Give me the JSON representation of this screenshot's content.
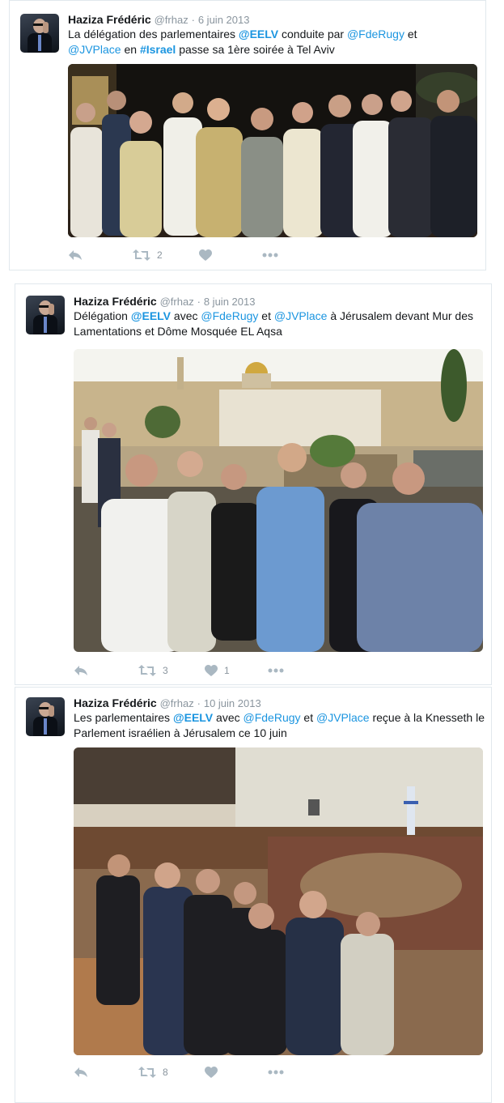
{
  "tweets": [
    {
      "name": "Haziza Frédéric",
      "handle": "@frhaz",
      "date": "6 juin 2013",
      "text": [
        {
          "t": "La délégation des parlementaires "
        },
        {
          "t": "@EELV",
          "link": true,
          "bold": true
        },
        {
          "t": " conduite par "
        },
        {
          "t": "@FdeRugy",
          "link": true
        },
        {
          "t": " et "
        },
        {
          "t": "@JVPlace",
          "link": true
        },
        {
          "t": " en "
        },
        {
          "t": "#Israel",
          "link": true,
          "bold": true
        },
        {
          "t": " passe sa 1ère soirée à Tel Aviv"
        }
      ],
      "retweets": "2",
      "likes": ""
    },
    {
      "name": "Haziza Frédéric",
      "handle": "@frhaz",
      "date": "8 juin 2013",
      "text": [
        {
          "t": "Délégation "
        },
        {
          "t": "@EELV",
          "link": true,
          "bold": true
        },
        {
          "t": " avec "
        },
        {
          "t": "@FdeRugy",
          "link": true
        },
        {
          "t": " et "
        },
        {
          "t": "@JVPlace",
          "link": true
        },
        {
          "t": " à Jérusalem devant Mur des Lamentations et Dôme Mosquée EL Aqsa"
        }
      ],
      "retweets": "3",
      "likes": "1"
    },
    {
      "name": "Haziza Frédéric",
      "handle": "@frhaz",
      "date": "10 juin 2013",
      "text": [
        {
          "t": "Les parlementaires "
        },
        {
          "t": "@EELV",
          "link": true,
          "bold": true
        },
        {
          "t": " avec "
        },
        {
          "t": "@FdeRugy",
          "link": true
        },
        {
          "t": " et "
        },
        {
          "t": "@JVPlace",
          "link": true
        },
        {
          "t": " reçue à la Knesseth le Parlement israélien à Jérusalem ce 10 juin"
        }
      ],
      "retweets": "8",
      "likes": ""
    }
  ],
  "icons": {
    "reply": "reply-icon",
    "retweet": "retweet-icon",
    "like": "heart-icon",
    "more": "more-icon"
  },
  "colors": {
    "link": "#1b95e0",
    "meta": "#8a959e",
    "action": "#aab8c2",
    "border": "#e1e8ed"
  }
}
